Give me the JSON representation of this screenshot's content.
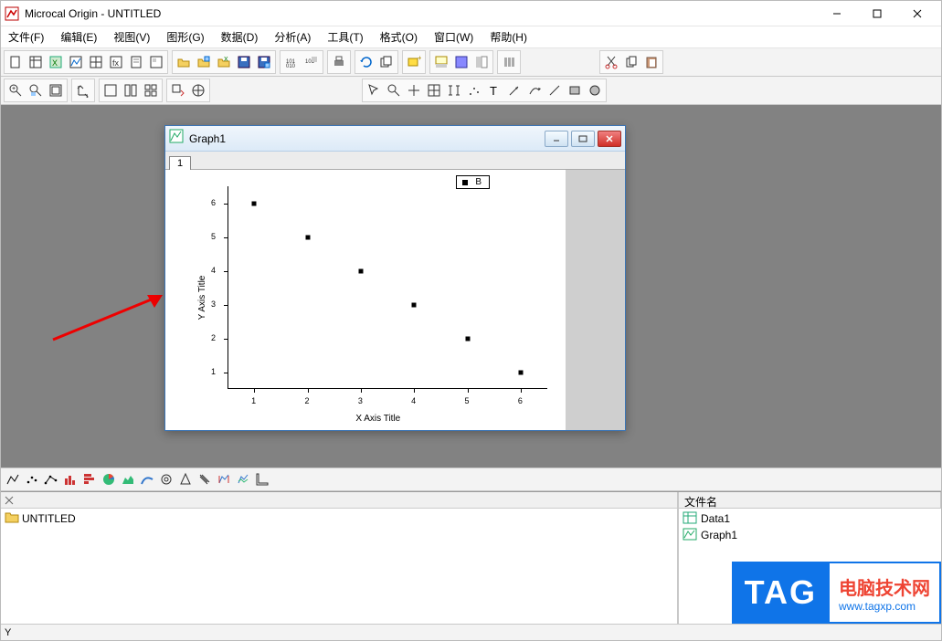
{
  "window": {
    "title": "Microcal Origin - UNTITLED",
    "buttons": {
      "min": "–",
      "max": "☐",
      "close": "✕"
    }
  },
  "menus": [
    "文件(F)",
    "编辑(E)",
    "视图(V)",
    "图形(G)",
    "数据(D)",
    "分析(A)",
    "工具(T)",
    "格式(O)",
    "窗口(W)",
    "帮助(H)"
  ],
  "child_window": {
    "title": "Graph1",
    "tab_label": "1"
  },
  "legend": {
    "series_label": "B"
  },
  "axes": {
    "x_title": "X Axis Title",
    "y_title": "Y Axis Title",
    "x_ticks": [
      "1",
      "2",
      "3",
      "4",
      "5",
      "6"
    ],
    "y_ticks": [
      "1",
      "2",
      "3",
      "4",
      "5",
      "6"
    ]
  },
  "chart_data": {
    "type": "scatter",
    "series": [
      {
        "name": "B",
        "x": [
          1,
          2,
          3,
          4,
          5,
          6
        ],
        "y": [
          6,
          5,
          4,
          3,
          2,
          1
        ]
      }
    ],
    "xlabel": "X Axis Title",
    "ylabel": "Y Axis Title",
    "xlim": [
      0.5,
      6.5
    ],
    "ylim": [
      0.5,
      6.5
    ]
  },
  "project_tree": {
    "root_label": "UNTITLED"
  },
  "file_list": {
    "header": "文件名",
    "items": [
      "Data1",
      "Graph1"
    ]
  },
  "status": {
    "text": "Y"
  },
  "watermark": {
    "tag": "TAG",
    "line1": "电脑技术网",
    "line2": "www.tagxp.com"
  }
}
